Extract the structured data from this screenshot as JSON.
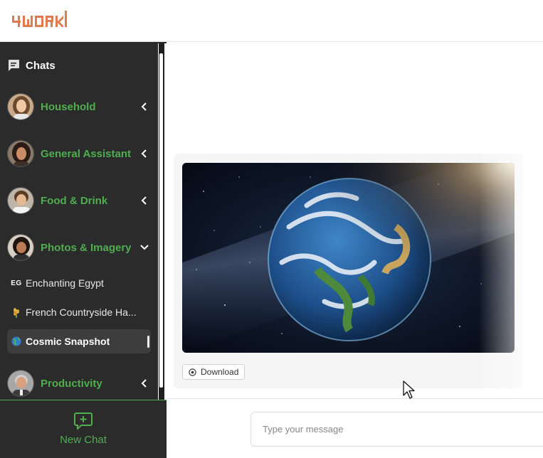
{
  "app": {
    "logo_text": "4WORK",
    "brand_color": "#e07b4f",
    "accent_color": "#4fae4f"
  },
  "sidebar": {
    "header_label": "Chats",
    "header_icon": "chat-bubble-icon",
    "categories": [
      {
        "label": "Household",
        "expanded": false,
        "chevron": "chevron-left-icon"
      },
      {
        "label": "General Assistant",
        "expanded": false,
        "chevron": "chevron-left-icon"
      },
      {
        "label": "Food & Drink",
        "expanded": false,
        "chevron": "chevron-left-icon"
      },
      {
        "label": "Photos & Imagery",
        "expanded": true,
        "chevron": "chevron-down-icon"
      },
      {
        "label": "Productivity",
        "expanded": false,
        "chevron": "chevron-left-icon"
      }
    ],
    "sub_items": [
      {
        "icon_text": "EG",
        "label": "Enchanting Egypt",
        "active": false
      },
      {
        "icon": "wheat-icon",
        "label": "French Countryside Ha...",
        "active": false
      },
      {
        "icon": "globe-icon",
        "label": "Cosmic Snapshot",
        "active": true
      }
    ],
    "new_chat_label": "New Chat"
  },
  "main": {
    "image_alt": "Earth from space",
    "download_label": "Download",
    "message_placeholder": "Type your message"
  }
}
